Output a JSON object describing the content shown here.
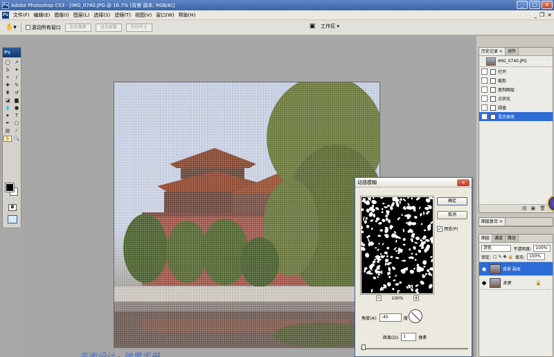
{
  "window": {
    "title": "Adobe Photoshop CS3 - [IMG_0740.JPG @ 16.7% (背景 副本, RGB/8)]",
    "app_badge": "Ps"
  },
  "menu": {
    "items": [
      "文件(F)",
      "编辑(E)",
      "图像(I)",
      "图层(L)",
      "选择(S)",
      "滤镜(T)",
      "视图(V)",
      "窗口(W)",
      "帮助(H)"
    ]
  },
  "options": {
    "scroll_all_label": "滚动所有窗口",
    "buttons": [
      "实际像素",
      "适合屏幕",
      "打印尺寸"
    ],
    "workspace": "工作区 ▾"
  },
  "toolbox": {
    "logo": "Ps"
  },
  "history_panel": {
    "tabs": [
      "历史记录 ×",
      "动作"
    ],
    "snapshot": "IMG_0740.JPG",
    "steps": [
      "打开",
      "裁剪",
      "复制图层",
      "点状化",
      "阈值",
      "混合更改"
    ],
    "selected_index": 5
  },
  "layers_panel": {
    "top_tabs": [
      "图层复合 ×"
    ],
    "tabs": [
      "图层",
      "通道",
      "路径"
    ],
    "blend_mode": "滤色",
    "opacity_label": "不透明度:",
    "opacity": "100%",
    "lock_label": "锁定:",
    "fill_label": "填充:",
    "fill": "100%",
    "layers": [
      {
        "name": "背景 副本",
        "selected": true
      },
      {
        "name": "背景",
        "selected": false
      }
    ]
  },
  "dialog": {
    "title": "动感模糊",
    "ok": "确定",
    "cancel": "取消",
    "preview_label": "预览(P)",
    "preview_checked": true,
    "zoom": "100%",
    "angle_label": "角度(A):",
    "angle_value": "-45",
    "angle_unit": "度",
    "distance_label": "距离(D):",
    "distance_value": "1",
    "distance_unit": "像素"
  },
  "watermark": "平面设计 · 效果手册"
}
